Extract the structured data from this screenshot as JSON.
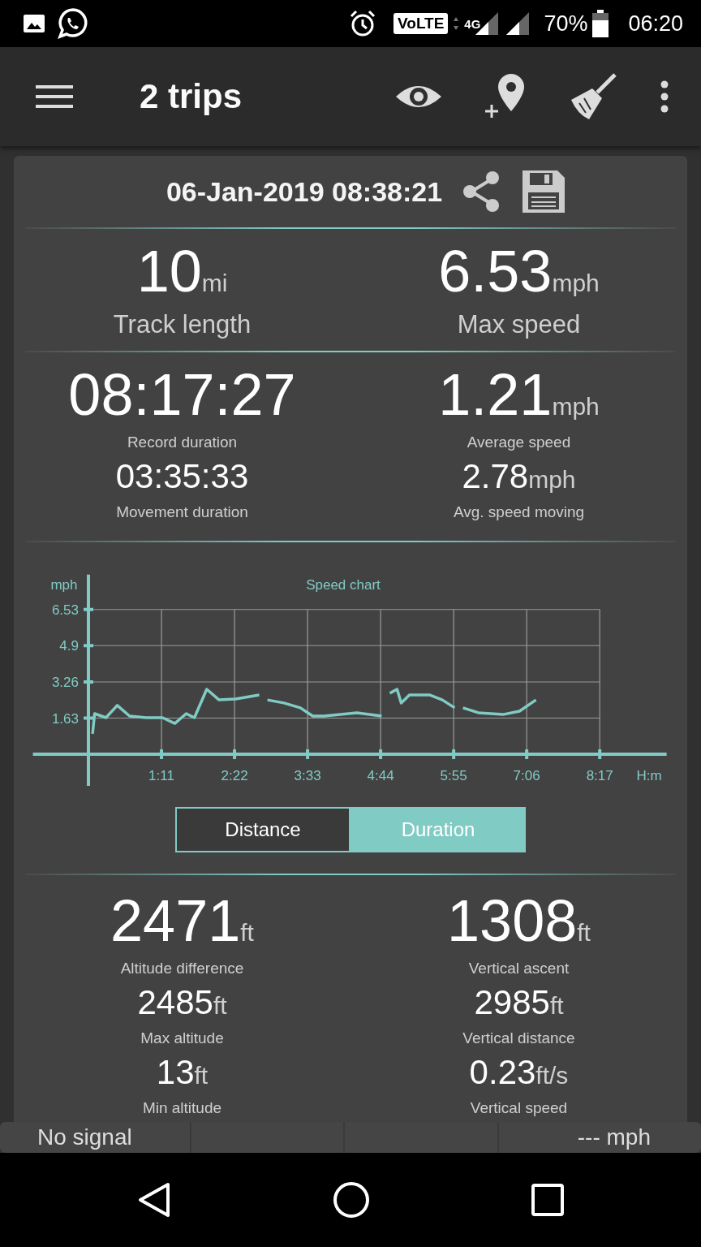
{
  "status_bar": {
    "network_badge": "VoLTE",
    "network_type": "4G",
    "battery": "70%",
    "time": "06:20"
  },
  "app_bar": {
    "title": "2 trips"
  },
  "trip": {
    "date": "06-Jan-2019 08:38:21",
    "sections": [
      {
        "rows": [
          [
            {
              "kind": "headline",
              "value": "10",
              "unit": "mi",
              "label": "Track length"
            },
            {
              "kind": "headline",
              "value": "6.53",
              "unit": "mph",
              "label": "Max speed"
            }
          ]
        ]
      },
      {
        "rows": [
          [
            {
              "kind": "primary",
              "value": "08:17:27",
              "label": "Record duration"
            },
            {
              "kind": "primary",
              "value": "1.21",
              "unit": "mph",
              "label": "Average speed"
            }
          ],
          [
            {
              "kind": "secondary",
              "value": "03:35:33",
              "label": "Movement duration"
            },
            {
              "kind": "secondary",
              "value": "2.78",
              "unit": "mph",
              "label": "Avg. speed moving"
            }
          ]
        ]
      }
    ],
    "chart_data": {
      "type": "line",
      "title": "Speed chart",
      "xlabel": "H:m",
      "ylabel": "mph",
      "grid": true,
      "xlim": [
        -54,
        562
      ],
      "ylim": [
        0,
        6.53
      ],
      "series": [
        {
          "color": "#80cbc4",
          "x": [
            4,
            6,
            17,
            28,
            40,
            56,
            72,
            84,
            95,
            103,
            115,
            127,
            143,
            166
          ],
          "values": [
            0.92,
            1.83,
            1.65,
            2.2,
            1.72,
            1.65,
            1.65,
            1.39,
            1.83,
            1.65,
            2.93,
            2.45,
            2.49,
            2.67
          ]
        },
        {
          "color": "#80cbc4",
          "x": [
            174,
            190,
            206,
            218,
            229,
            245,
            261,
            285
          ],
          "values": [
            2.45,
            2.31,
            2.09,
            1.72,
            1.72,
            1.79,
            1.87,
            1.72
          ]
        },
        {
          "color": "#80cbc4",
          "x": [
            293,
            300,
            304,
            312,
            332,
            344,
            356
          ],
          "values": [
            2.75,
            2.93,
            2.31,
            2.67,
            2.67,
            2.45,
            2.09
          ]
        },
        {
          "color": "#80cbc4",
          "x": [
            364,
            379,
            403,
            419,
            435
          ],
          "values": [
            2.09,
            1.87,
            1.79,
            1.94,
            2.45
          ]
        }
      ],
      "xticks": [
        {
          "value": 71,
          "label": "1:11"
        },
        {
          "value": 142,
          "label": "2:22"
        },
        {
          "value": 213,
          "label": "3:33"
        },
        {
          "value": 284,
          "label": "4:44"
        },
        {
          "value": 355,
          "label": "5:55"
        },
        {
          "value": 426,
          "label": "7:06"
        },
        {
          "value": 497,
          "label": "8:17"
        }
      ],
      "yticks": [
        1.63,
        3.26,
        4.9,
        6.53
      ]
    },
    "chart_modes": [
      {
        "label": "Distance",
        "selected": false
      },
      {
        "label": "Duration",
        "selected": true
      }
    ],
    "altitude": {
      "rows": [
        [
          {
            "kind": "headline-small",
            "value": "2471",
            "unit": "ft",
            "label": "Altitude difference"
          },
          {
            "kind": "headline-small",
            "value": "1308",
            "unit": "ft",
            "label": "Vertical ascent"
          }
        ],
        [
          {
            "kind": "secondary",
            "value": "2485",
            "unit": "ft",
            "label": "Max altitude"
          },
          {
            "kind": "secondary",
            "value": "2985",
            "unit": "ft",
            "label": "Vertical distance"
          }
        ],
        [
          {
            "kind": "secondary",
            "value": "13",
            "unit": "ft",
            "label": "Min altitude"
          },
          {
            "kind": "secondary",
            "value": "0.23",
            "unit": "ft/s",
            "label": "Vertical speed"
          }
        ]
      ]
    }
  },
  "gps_bar": {
    "signal": "No signal",
    "speed": "--- mph"
  }
}
